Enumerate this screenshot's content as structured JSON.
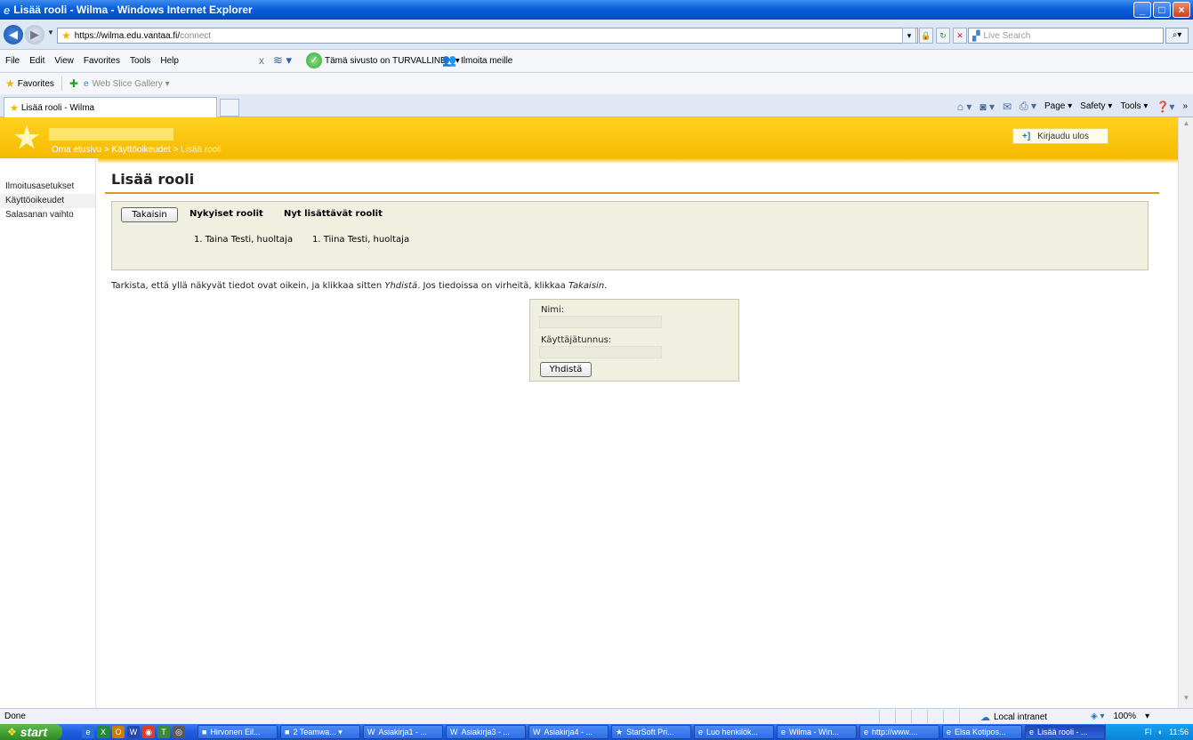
{
  "window": {
    "title": "Lisää rooli - Wilma - Windows Internet Explorer",
    "controls": {
      "minimize": "_",
      "maximize": "□",
      "close": "×"
    }
  },
  "address": {
    "url_host": "https://wilma.edu.vantaa.fi/",
    "url_path": "connect",
    "search_placeholder": "Live Search"
  },
  "menu": {
    "items": [
      "File",
      "Edit",
      "View",
      "Favorites",
      "Tools",
      "Help"
    ],
    "close_label": "x",
    "safe_label": "Tämä sivusto on TURVALLINEN ▾",
    "report_label": "Ilmoita meille"
  },
  "favorites_bar": {
    "favorites_label": "Favorites",
    "web_slice_label": "Web Slice Gallery ▾"
  },
  "tabs": [
    {
      "label": "Lisää rooli - Wilma"
    }
  ],
  "command_bar": {
    "page_label": "Page ▾",
    "safety_label": "Safety ▾",
    "tools_label": "Tools ▾",
    "more_label": "»"
  },
  "wilma": {
    "breadcrumb": {
      "home": "Oma etusivu",
      "sep": ">",
      "section": "Käyttöoikeudet",
      "current": "Lisää rooli"
    },
    "logout_label": "Kirjaudu ulos",
    "sidebar": [
      {
        "label": "Ilmoitusasetukset"
      },
      {
        "label": "Käyttöoikeudet"
      },
      {
        "label": "Salasanan vaihto"
      }
    ],
    "page_title": "Lisää rooli",
    "back_button": "Takaisin",
    "current_roles_header": "Nykyiset roolit",
    "new_roles_header": "Nyt lisättävät roolit",
    "current_roles": [
      "1. Taina Testi, huoltaja"
    ],
    "new_roles": [
      "1. Tiina Testi, huoltaja"
    ],
    "instruction_pre": "Tarkista, että yllä näkyvät tiedot ovat oikein, ja klikkaa sitten ",
    "instruction_link1": "Yhdistä",
    "instruction_mid": ". Jos tiedoissa on virheitä, klikkaa ",
    "instruction_link2": "Takaisin",
    "instruction_post": ".",
    "login": {
      "name_label": "Nimi:",
      "username_label": "Käyttäjätunnus:",
      "join_button": "Yhdistä"
    }
  },
  "status_bar": {
    "status": "Done",
    "zone": "Local intranet",
    "zoom": "100%"
  },
  "taskbar": {
    "start_label": "start",
    "tasks": [
      {
        "label": "Hirvonen Eil..."
      },
      {
        "label": "2 Teamwa... ▾"
      },
      {
        "label": "Asiakirja1 - ..."
      },
      {
        "label": "Asiakirja3 - ..."
      },
      {
        "label": "Asiakirja4 - ..."
      },
      {
        "label": "StarSoft Pri..."
      },
      {
        "label": "Luo henkilök..."
      },
      {
        "label": "Wilma - Win..."
      },
      {
        "label": "http://www...."
      },
      {
        "label": "Elsa Kotipos..."
      },
      {
        "label": "Lisää rooli - ..."
      }
    ],
    "tray_lang": "FI",
    "clock": "11:56"
  }
}
